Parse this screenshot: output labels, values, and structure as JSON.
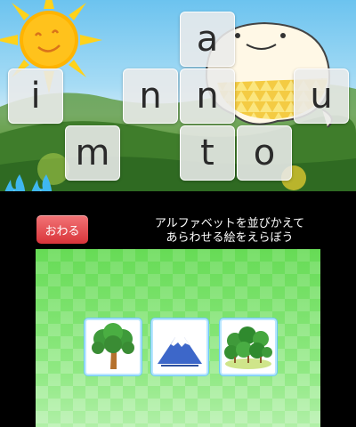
{
  "letter_tiles": [
    {
      "letter": "a"
    },
    {
      "letter": "i"
    },
    {
      "letter": "n"
    },
    {
      "letter": "n"
    },
    {
      "letter": "u"
    },
    {
      "letter": "m"
    },
    {
      "letter": "t"
    },
    {
      "letter": "o"
    }
  ],
  "end_button": {
    "label": "おわる"
  },
  "instruction": {
    "line1": "アルファベットを並びかえて",
    "line2": "あらわせる絵をえらぼう"
  },
  "picture_cards": [
    {
      "picture": "tree-icon"
    },
    {
      "picture": "mountain-icon"
    },
    {
      "picture": "forest-icon"
    }
  ],
  "colors": {
    "end_button": "#e0464a",
    "board_green": "#7de56e",
    "card_border": "#6dc8f5",
    "flame": "#3fb7f0"
  }
}
